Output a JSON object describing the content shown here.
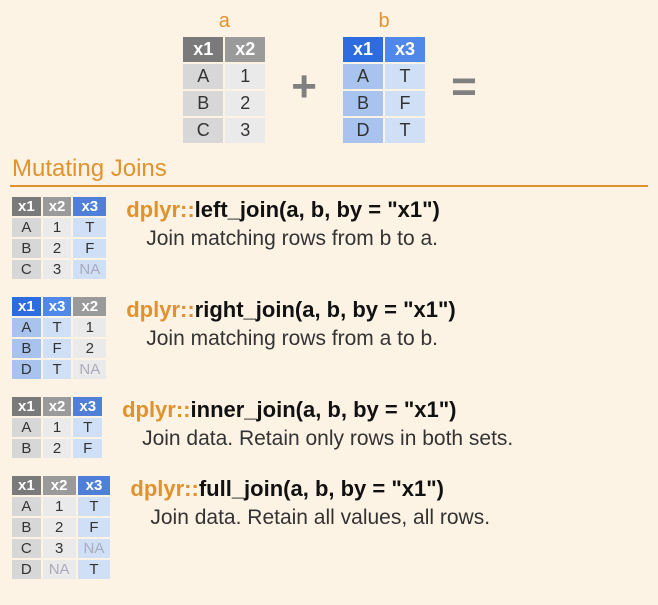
{
  "diagram": {
    "label_a": "a",
    "label_b": "b",
    "plus": "+",
    "equals": "=",
    "table_a": {
      "headers": [
        "x1",
        "x2"
      ],
      "rows": [
        [
          "A",
          "1"
        ],
        [
          "B",
          "2"
        ],
        [
          "C",
          "3"
        ]
      ]
    },
    "table_b": {
      "headers": [
        "x1",
        "x3"
      ],
      "rows": [
        [
          "A",
          "T"
        ],
        [
          "B",
          "F"
        ],
        [
          "D",
          "T"
        ]
      ]
    }
  },
  "section_title": "Mutating Joins",
  "joins": [
    {
      "id": "left",
      "pkg": "dplyr::",
      "fn": "left_join(a, b, by = \"x1\")",
      "desc": "Join matching rows from b to a.",
      "variant": "mix",
      "table": {
        "headers": [
          "x1",
          "x2",
          "x3"
        ],
        "rows": [
          [
            "A",
            "1",
            "T"
          ],
          [
            "B",
            "2",
            "F"
          ],
          [
            "C",
            "3",
            "NA"
          ]
        ]
      }
    },
    {
      "id": "right",
      "pkg": "dplyr::",
      "fn": "right_join(a, b, by = \"x1\")",
      "desc": "Join matching rows from a to b.",
      "variant": "mix-r",
      "table": {
        "headers": [
          "x1",
          "x3",
          "x2"
        ],
        "rows": [
          [
            "A",
            "T",
            "1"
          ],
          [
            "B",
            "F",
            "2"
          ],
          [
            "D",
            "T",
            "NA"
          ]
        ]
      }
    },
    {
      "id": "inner",
      "pkg": "dplyr::",
      "fn": "inner_join(a, b, by = \"x1\")",
      "desc": "Join data. Retain only rows in both sets.",
      "variant": "mix",
      "table": {
        "headers": [
          "x1",
          "x2",
          "x3"
        ],
        "rows": [
          [
            "A",
            "1",
            "T"
          ],
          [
            "B",
            "2",
            "F"
          ]
        ]
      }
    },
    {
      "id": "full",
      "pkg": "dplyr::",
      "fn": "full_join(a, b, by = \"x1\")",
      "desc": "Join data. Retain all values, all rows.",
      "variant": "mix",
      "table": {
        "headers": [
          "x1",
          "x2",
          "x3"
        ],
        "rows": [
          [
            "A",
            "1",
            "T"
          ],
          [
            "B",
            "2",
            "F"
          ],
          [
            "C",
            "3",
            "NA"
          ],
          [
            "D",
            "NA",
            "T"
          ]
        ]
      }
    }
  ]
}
